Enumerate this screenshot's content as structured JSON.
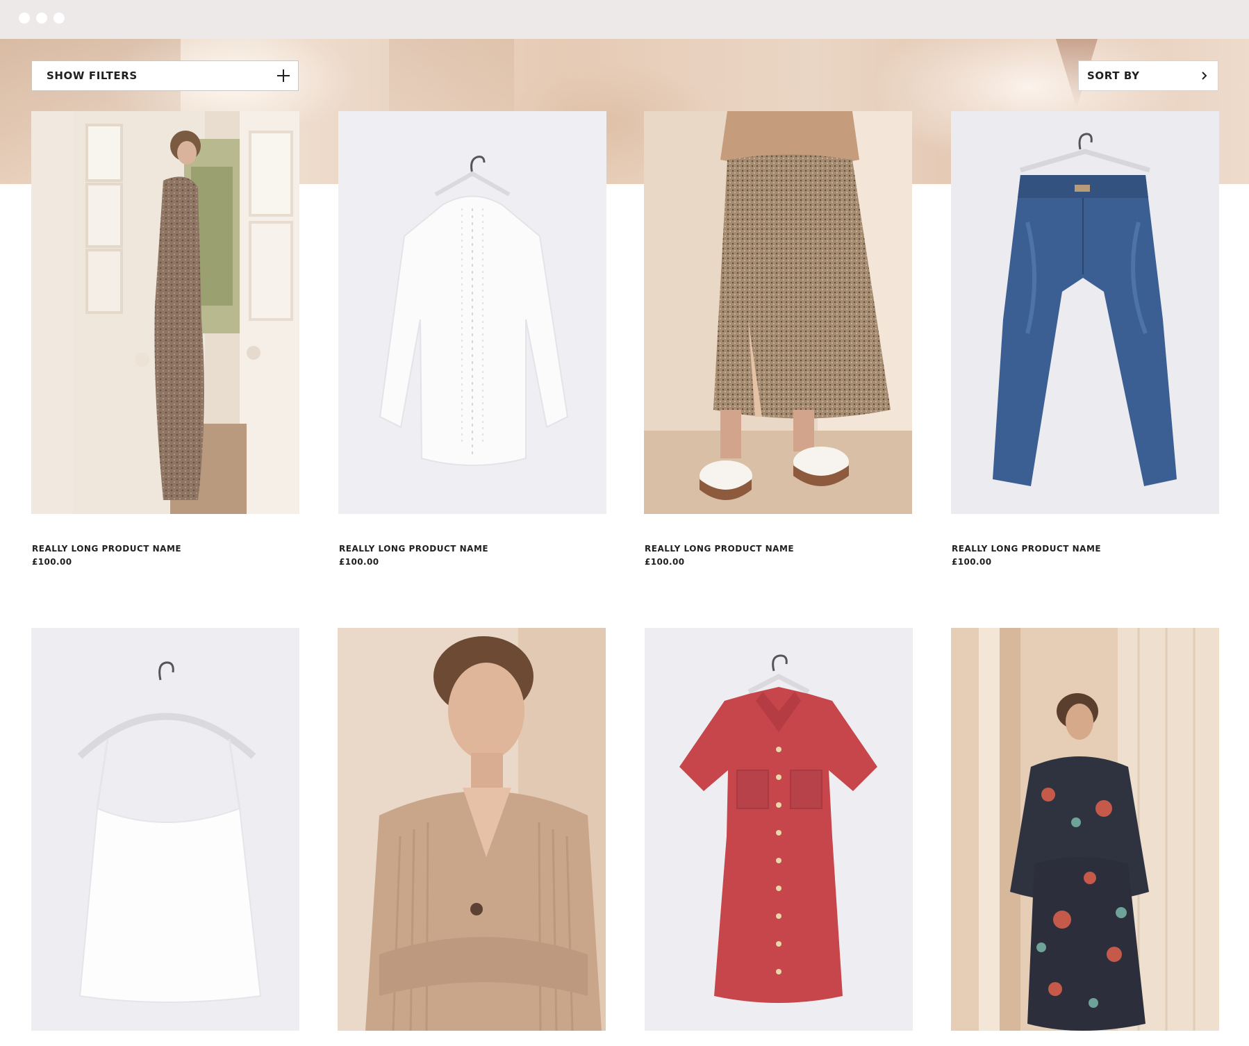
{
  "window": {
    "controls": [
      "dot",
      "dot",
      "dot"
    ]
  },
  "toolbar": {
    "filters_label": "SHOW FILTERS",
    "filters_icon": "plus-icon",
    "sort_label": "SORT BY",
    "sort_icon": "chevron-right-icon"
  },
  "products": [
    {
      "name": "REALLY LONG PRODUCT NAME",
      "price": "£100.00",
      "image": "model in leopard print maxi dress by french door"
    },
    {
      "name": "REALLY LONG PRODUCT NAME",
      "price": "£100.00",
      "image": "white lace blouse on hanger"
    },
    {
      "name": "REALLY LONG PRODUCT NAME",
      "price": "£100.00",
      "image": "model in leopard print midi skirt and white trainers"
    },
    {
      "name": "REALLY LONG PRODUCT NAME",
      "price": "£100.00",
      "image": "blue straight leg jeans on hanger"
    },
    {
      "name": "",
      "price": "",
      "image": "white cami top on hanger"
    },
    {
      "name": "",
      "price": "",
      "image": "model in beige ribbed cardigan"
    },
    {
      "name": "",
      "price": "",
      "image": "red suede shirt dress on hanger"
    },
    {
      "name": "",
      "price": "",
      "image": "model in dark floral print dress"
    }
  ],
  "colors": {
    "chrome_bg": "#ece9e8",
    "hero_tone": "#e7cfbb",
    "studio_bg": "#f0f0f4",
    "text": "#1f1f1f",
    "border": "#c9c6c4"
  }
}
